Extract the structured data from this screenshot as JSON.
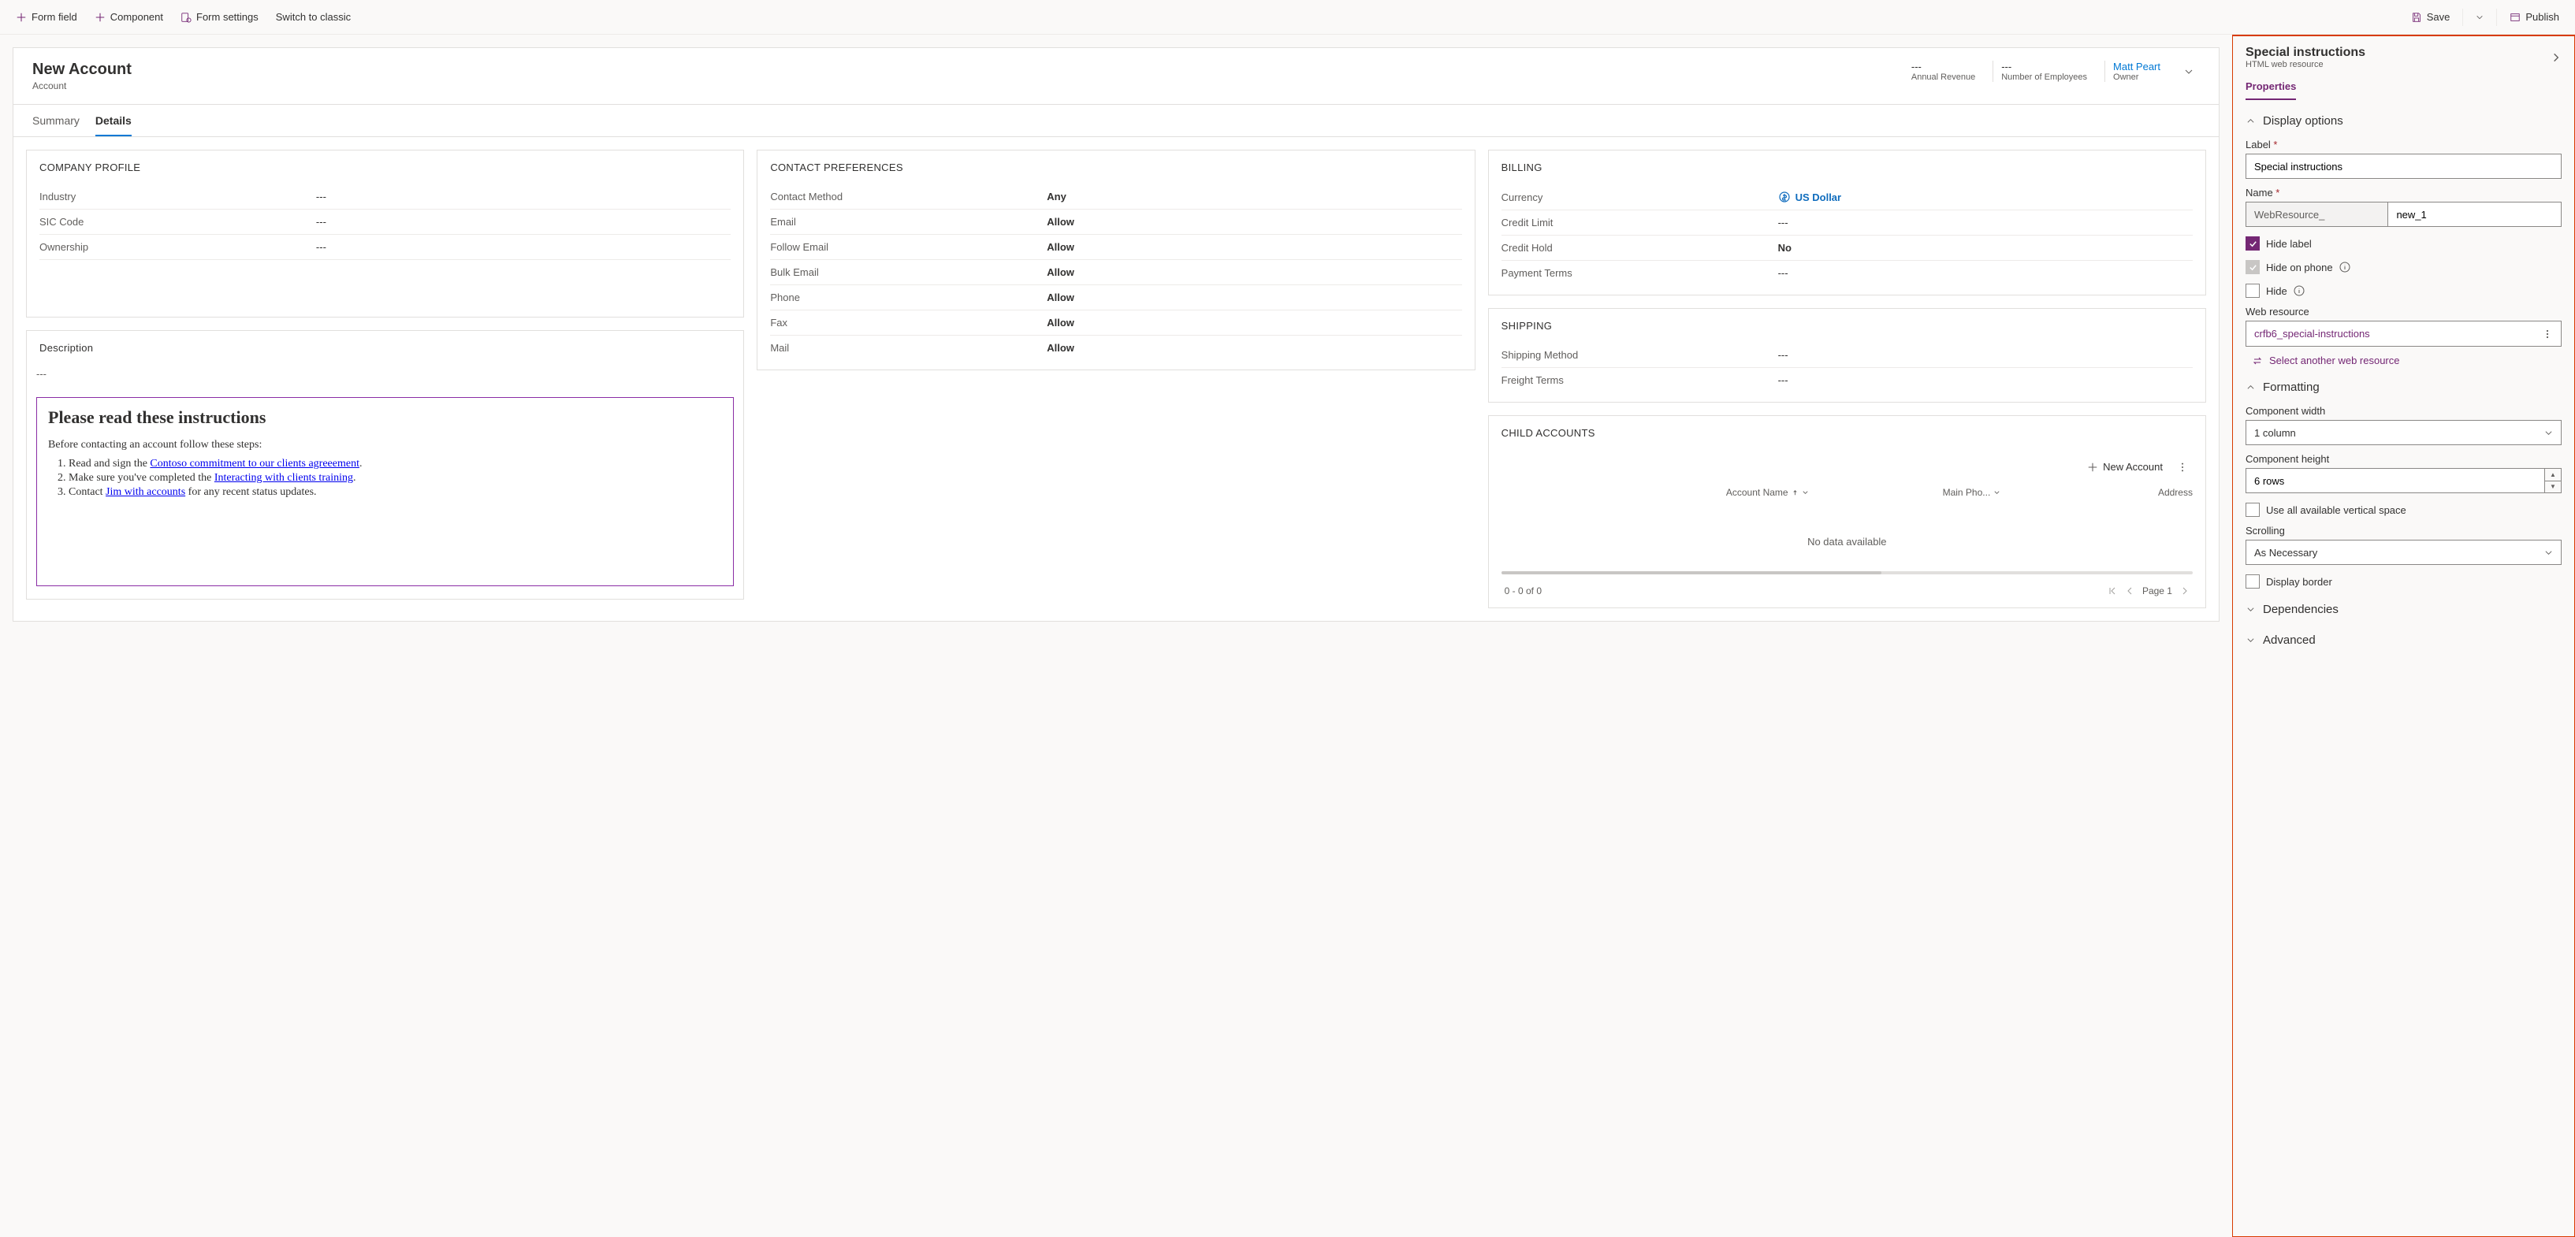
{
  "toolbar": {
    "formField": "Form field",
    "component": "Component",
    "formSettings": "Form settings",
    "switchClassic": "Switch to classic",
    "save": "Save",
    "publish": "Publish"
  },
  "header": {
    "title": "New Account",
    "entity": "Account",
    "metrics": [
      {
        "value": "---",
        "label": "Annual Revenue",
        "link": false
      },
      {
        "value": "---",
        "label": "Number of Employees",
        "link": false
      },
      {
        "value": "Matt Peart",
        "label": "Owner",
        "link": true
      }
    ]
  },
  "tabs": [
    "Summary",
    "Details"
  ],
  "activeTab": 1,
  "companyProfile": {
    "title": "COMPANY PROFILE",
    "fields": [
      {
        "label": "Industry",
        "value": "---"
      },
      {
        "label": "SIC Code",
        "value": "---"
      },
      {
        "label": "Ownership",
        "value": "---"
      }
    ]
  },
  "description": {
    "title": "Description",
    "value": "---"
  },
  "instructions": {
    "heading": "Please read these instructions",
    "intro": "Before contacting an account follow these steps:",
    "item1_pre": "Read and sign the ",
    "item1_link": "Contoso commitment to our clients agreeement",
    "item1_post": ".",
    "item2_pre": "Make sure you've completed the ",
    "item2_link": "Interacting with clients training",
    "item2_post": ".",
    "item3_pre": "Contact ",
    "item3_link": "Jim with accounts",
    "item3_post": " for any recent status updates."
  },
  "contactPrefs": {
    "title": "CONTACT PREFERENCES",
    "fields": [
      {
        "label": "Contact Method",
        "value": "Any"
      },
      {
        "label": "Email",
        "value": "Allow"
      },
      {
        "label": "Follow Email",
        "value": "Allow"
      },
      {
        "label": "Bulk Email",
        "value": "Allow"
      },
      {
        "label": "Phone",
        "value": "Allow"
      },
      {
        "label": "Fax",
        "value": "Allow"
      },
      {
        "label": "Mail",
        "value": "Allow"
      }
    ]
  },
  "billing": {
    "title": "BILLING",
    "fields": [
      {
        "label": "Currency",
        "value": "US Dollar",
        "icon": true
      },
      {
        "label": "Credit Limit",
        "value": "---"
      },
      {
        "label": "Credit Hold",
        "value": "No"
      },
      {
        "label": "Payment Terms",
        "value": "---"
      }
    ]
  },
  "shipping": {
    "title": "SHIPPING",
    "fields": [
      {
        "label": "Shipping Method",
        "value": "---"
      },
      {
        "label": "Freight Terms",
        "value": "---"
      }
    ]
  },
  "childAccounts": {
    "title": "CHILD ACCOUNTS",
    "newLabel": "New Account",
    "cols": {
      "name": "Account Name",
      "phone": "Main Pho...",
      "address": "Address"
    },
    "empty": "No data available",
    "range": "0 - 0 of 0",
    "page": "Page 1"
  },
  "panel": {
    "title": "Special instructions",
    "subtitle": "HTML web resource",
    "tab": "Properties",
    "groups": {
      "display": "Display options",
      "formatting": "Formatting",
      "dependencies": "Dependencies",
      "advanced": "Advanced"
    },
    "labelField": {
      "label": "Label",
      "value": "Special instructions"
    },
    "nameField": {
      "label": "Name",
      "prefix": "WebResource_",
      "value": "new_1"
    },
    "hideLabel": "Hide label",
    "hideOnPhone": "Hide on phone",
    "hide": "Hide",
    "webResource": {
      "label": "Web resource",
      "value": "crfb6_special-instructions"
    },
    "selectAnother": "Select another web resource",
    "compWidth": {
      "label": "Component width",
      "value": "1 column"
    },
    "compHeight": {
      "label": "Component height",
      "value": "6 rows"
    },
    "useAllVertical": "Use all available vertical space",
    "scrolling": {
      "label": "Scrolling",
      "value": "As Necessary"
    },
    "displayBorder": "Display border"
  }
}
